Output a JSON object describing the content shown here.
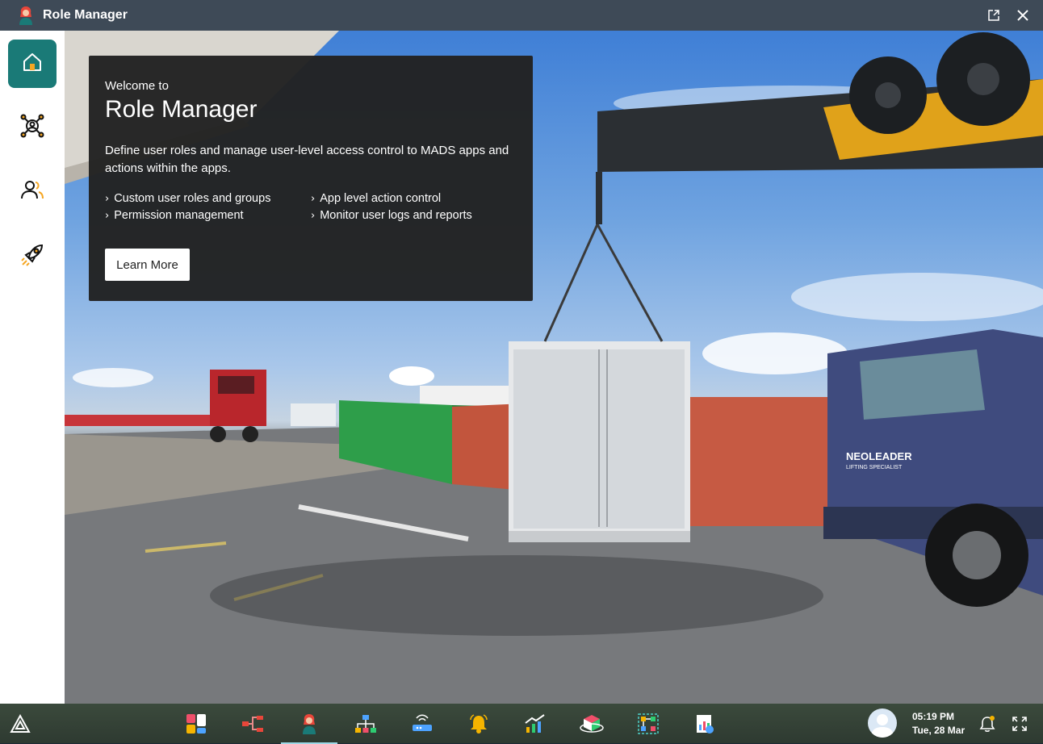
{
  "window": {
    "title": "Role Manager",
    "icons": [
      "role-manager-logo-icon",
      "pop-out-icon",
      "close-icon"
    ]
  },
  "sidebar": {
    "items": [
      {
        "name": "home",
        "icon": "home-icon",
        "active": true
      },
      {
        "name": "user-network",
        "icon": "user-network-icon",
        "active": false
      },
      {
        "name": "users",
        "icon": "users-icon",
        "active": false
      },
      {
        "name": "launch",
        "icon": "rocket-icon",
        "active": false
      }
    ]
  },
  "welcome": {
    "eyebrow": "Welcome to",
    "title": "Role Manager",
    "description": "Define user roles and manage user-level access control to MADS apps and actions within the apps.",
    "features": [
      "Custom user roles and groups",
      "Permission management",
      "App level action control",
      "Monitor user logs and reports"
    ],
    "learn_more": "Learn More"
  },
  "background": {
    "truck_text": "NEOLEADER",
    "truck_subtext": "LIFTING SPECIALIST"
  },
  "taskbar": {
    "apps": [
      "dashboard-grid-icon",
      "flow-icon",
      "role-manager-icon",
      "org-chart-icon",
      "router-icon",
      "bell-alert-icon",
      "growth-chart-icon",
      "cube-icon",
      "network-grid-icon",
      "report-icon"
    ],
    "active_app": "role-manager-icon",
    "time": "05:19 PM",
    "date": "Tue, 28 Mar",
    "notification_dot_color": "#f5b400"
  },
  "colors": {
    "accent": "#1a7a77",
    "titlebar": "#3e4a57",
    "card": "#222222"
  }
}
